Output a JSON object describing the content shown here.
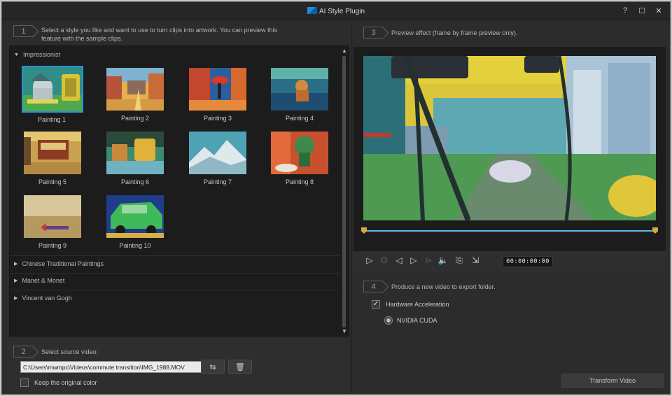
{
  "window": {
    "title": "AI Style Plugin",
    "controls": {
      "help": "?",
      "maximize": "☐",
      "close": "✕"
    }
  },
  "step1": {
    "number": "1",
    "text_line1": "Select a style you like and want to use to turn clips into artwork. You can preview this",
    "text_line2": "feature with the sample clips."
  },
  "styles": {
    "expanded_category": "Impressionist",
    "paintings": [
      {
        "label": "Painting 1",
        "selected": true
      },
      {
        "label": "Painting 2",
        "selected": false
      },
      {
        "label": "Painting 3",
        "selected": false
      },
      {
        "label": "Painting 4",
        "selected": false
      },
      {
        "label": "Painting 5",
        "selected": false
      },
      {
        "label": "Painting 6",
        "selected": false
      },
      {
        "label": "Painting 7",
        "selected": false
      },
      {
        "label": "Painting 8",
        "selected": false
      },
      {
        "label": "Painting 9",
        "selected": false
      },
      {
        "label": "Painting 10",
        "selected": false
      }
    ],
    "collapsed_categories": [
      "Chinese Traditional Paintings",
      "Manet & Monet",
      "Vincent van Gogh"
    ]
  },
  "step2": {
    "number": "2",
    "label": "Select source video:",
    "path": "C:\\Users\\mwmpc\\Videos\\commute transition\\IMG_1988.MOV",
    "keep_color_label": "Keep the original color",
    "keep_color_checked": false
  },
  "step3": {
    "number": "3",
    "text": "Preview effect (frame by frame preview only)."
  },
  "player": {
    "timecode": "00:00:00:00",
    "progress": 0
  },
  "step4": {
    "number": "4",
    "text": "Produce a new video to export folder.",
    "hw_accel_label": "Hardware Acceleration",
    "hw_accel_checked": true,
    "engine_label": "NVIDIA CUDA",
    "transform_label": "Transform Video"
  },
  "colors": {
    "accent_blue": "#2b8fe0",
    "timeline_blue": "#5fb8ec",
    "marker_gold": "#d8a93c",
    "panel_dark": "#1c1c1c",
    "window_bg": "#2c2c2c"
  }
}
